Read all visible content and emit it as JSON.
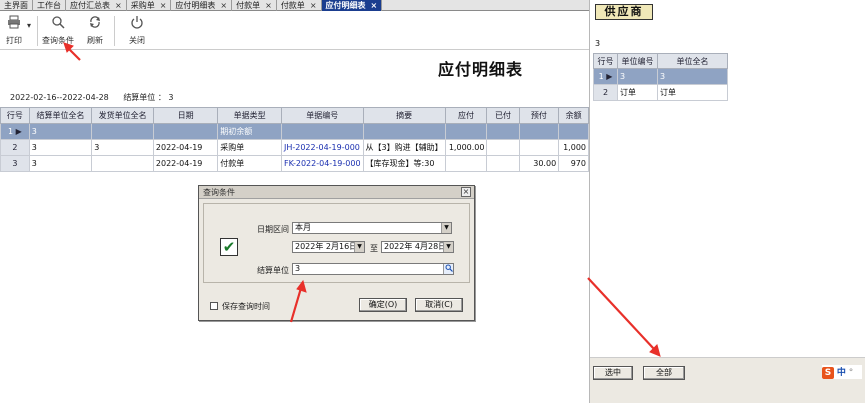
{
  "tabs": [
    {
      "label": "主界面",
      "closable": false,
      "active": false
    },
    {
      "label": "工作台",
      "closable": false,
      "active": false
    },
    {
      "label": "应付汇总表",
      "closable": true,
      "active": false
    },
    {
      "label": "采购单",
      "closable": true,
      "active": false
    },
    {
      "label": "应付明细表",
      "closable": true,
      "active": false
    },
    {
      "label": "付款单",
      "closable": true,
      "active": false
    },
    {
      "label": "付款单",
      "closable": true,
      "active": false
    },
    {
      "label": "应付明细表",
      "closable": true,
      "active": true
    }
  ],
  "toolbar": {
    "print_label": "打印",
    "query_label": "查询条件",
    "refresh_label": "刷新",
    "close_label": "关闭"
  },
  "report": {
    "title": "应付明细表",
    "date_range": "2022-02-16--2022-04-28",
    "settle_unit_text": "结算单位 ： 3"
  },
  "grid": {
    "columns": [
      "行号",
      "结算单位全名",
      "发货单位全名",
      "日期",
      "单据类型",
      "单据编号",
      "摘要",
      "应付",
      "已付",
      "预付",
      "余额"
    ],
    "rows": [
      {
        "no": "1",
        "settle": "3",
        "ship": "",
        "date": "",
        "type": "期初余额",
        "code": "",
        "memo": "",
        "payable": "",
        "paid": "",
        "prepaid": "",
        "balance": "",
        "selected": true
      },
      {
        "no": "2",
        "settle": "3",
        "ship": "3",
        "date": "2022-04-19",
        "type": "采购单",
        "code": "JH-2022-04-19-000",
        "memo": "从【3】购进【辅助】",
        "payable": "1,000.00",
        "paid": "",
        "prepaid": "",
        "balance": "1,000",
        "selected": false
      },
      {
        "no": "3",
        "settle": "3",
        "ship": "",
        "date": "2022-04-19",
        "type": "付款单",
        "code": "FK-2022-04-19-000",
        "memo": "【库存现金】等:30",
        "payable": "",
        "paid": "",
        "prepaid": "30.00",
        "balance": "970",
        "selected": false
      }
    ]
  },
  "dialog": {
    "title": "查询条件",
    "close": "×",
    "date_label": "日期区间",
    "period_value": "本月",
    "start_date": "2022年 2月16日",
    "to_label": "至",
    "end_date": "2022年 4月28日",
    "unit_label": "结算单位",
    "unit_value": "3",
    "save_label": "保存查询时间",
    "ok_label": "确定(O)",
    "cancel_label": "取消(C)"
  },
  "side": {
    "title": "供应商",
    "value": "3",
    "columns": [
      "行号",
      "单位编号",
      "单位全名"
    ],
    "rows": [
      {
        "no": "1",
        "code": "3",
        "name": "3",
        "selected": true
      },
      {
        "no": "2",
        "code": "订单",
        "name": "订单",
        "selected": false
      }
    ],
    "select_label": "选中",
    "all_label": "全部",
    "ime_label": "中"
  },
  "colors": {
    "active_tab": "#1a3d8f",
    "selected_row": "#8fa3c3",
    "code_blue": "#1a2fb0",
    "annotation_arrow": "#e8302a"
  }
}
